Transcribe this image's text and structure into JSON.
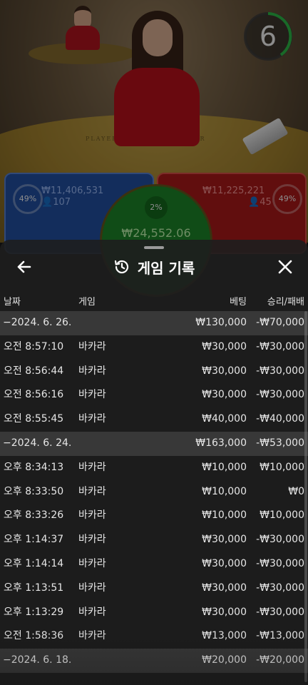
{
  "stream": {
    "countdown": "6",
    "table_labels": {
      "player": "PLAYER",
      "banker": "BANKER"
    }
  },
  "bets": {
    "player": {
      "percent": "49%",
      "amount": "₩11,406,531",
      "players": "107"
    },
    "banker": {
      "percent": "49%",
      "amount": "₩11,225,221",
      "players": "45"
    },
    "tie": {
      "percent": "2%",
      "amount": "₩24,552.06"
    }
  },
  "history": {
    "title": "게임 기록",
    "back_icon": "arrow-left-icon",
    "close_icon": "close-icon",
    "history_icon": "history-clock-icon",
    "columns": {
      "date": "날짜",
      "game": "게임",
      "bet": "베팅",
      "result": "승리/패배"
    },
    "rows": [
      {
        "type": "date",
        "time": "−2024. 6. 26.",
        "game": "",
        "bet": "₩130,000",
        "result": "-₩70,000"
      },
      {
        "type": "entry",
        "time": "오전 8:57:10",
        "game": "바카라",
        "bet": "₩30,000",
        "result": "-₩30,000"
      },
      {
        "type": "entry",
        "time": "오전 8:56:44",
        "game": "바카라",
        "bet": "₩30,000",
        "result": "-₩30,000"
      },
      {
        "type": "entry",
        "time": "오전 8:56:16",
        "game": "바카라",
        "bet": "₩30,000",
        "result": "-₩30,000"
      },
      {
        "type": "entry",
        "time": "오전 8:55:45",
        "game": "바카라",
        "bet": "₩40,000",
        "result": "-₩40,000"
      },
      {
        "type": "date",
        "time": "−2024. 6. 24.",
        "game": "",
        "bet": "₩163,000",
        "result": "-₩53,000"
      },
      {
        "type": "entry",
        "time": "오후 8:34:13",
        "game": "바카라",
        "bet": "₩10,000",
        "result": "₩10,000"
      },
      {
        "type": "entry",
        "time": "오후 8:33:50",
        "game": "바카라",
        "bet": "₩10,000",
        "result": "₩0"
      },
      {
        "type": "entry",
        "time": "오후 8:33:26",
        "game": "바카라",
        "bet": "₩10,000",
        "result": "₩10,000"
      },
      {
        "type": "entry",
        "time": "오후 1:14:37",
        "game": "바카라",
        "bet": "₩30,000",
        "result": "-₩30,000"
      },
      {
        "type": "entry",
        "time": "오후 1:14:14",
        "game": "바카라",
        "bet": "₩30,000",
        "result": "-₩30,000"
      },
      {
        "type": "entry",
        "time": "오후 1:13:51",
        "game": "바카라",
        "bet": "₩30,000",
        "result": "-₩30,000"
      },
      {
        "type": "entry",
        "time": "오후 1:13:29",
        "game": "바카라",
        "bet": "₩30,000",
        "result": "-₩30,000"
      },
      {
        "type": "entry",
        "time": "오전 1:58:36",
        "game": "바카라",
        "bet": "₩13,000",
        "result": "-₩13,000"
      },
      {
        "type": "date",
        "time": "−2024. 6. 18.",
        "game": "",
        "bet": "₩20,000",
        "result": "-₩20,000"
      }
    ]
  }
}
